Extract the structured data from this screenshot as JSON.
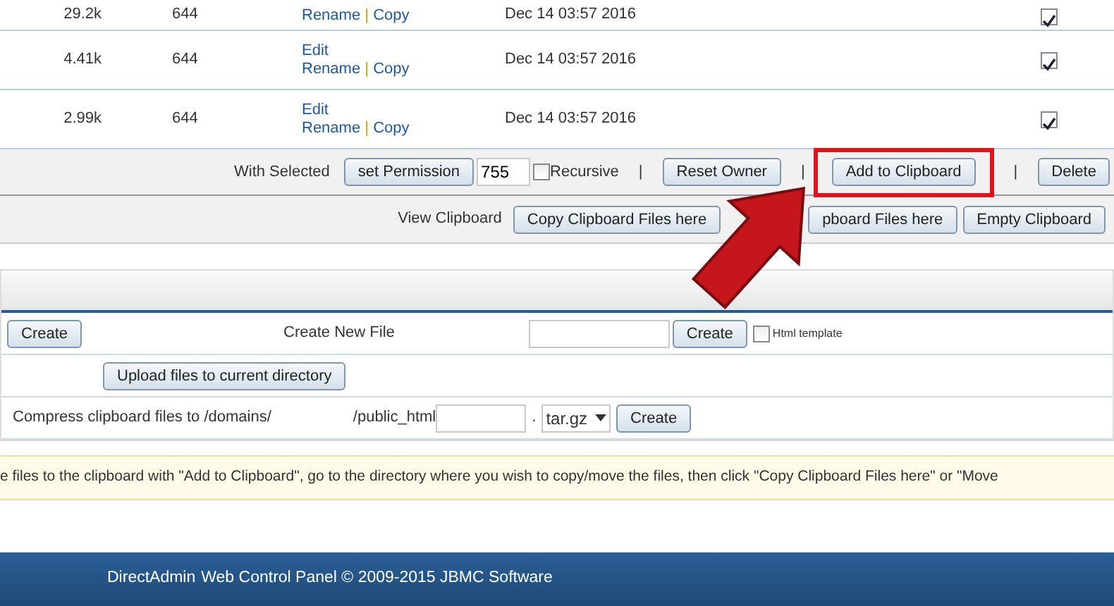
{
  "files": [
    {
      "size": "29.2k",
      "permission": "644",
      "actions": [
        "Rename",
        "Copy"
      ],
      "date": "Dec 14 03:57 2016",
      "checked": true
    },
    {
      "size": "4.41k",
      "permission": "644",
      "edit": "Edit",
      "actions": [
        "Rename",
        "Copy"
      ],
      "date": "Dec 14 03:57 2016",
      "checked": true
    },
    {
      "size": "2.99k",
      "permission": "644",
      "edit": "Edit",
      "actions": [
        "Rename",
        "Copy"
      ],
      "date": "Dec 14 03:57 2016",
      "checked": true
    }
  ],
  "action_separator": "|",
  "with_selected": {
    "label": "With Selected",
    "set_permission": "set Permission",
    "permission_value": "755",
    "recursive": {
      "label": "Recursive",
      "checked": false
    },
    "buttons": [
      {
        "separator": "|",
        "label": "Reset Owner",
        "highlighted": false
      },
      {
        "separator": "|",
        "label": "Add to Clipboard",
        "highlighted": true
      },
      {
        "separator": "|",
        "label": "Delete",
        "highlighted": false
      }
    ]
  },
  "clipboard": {
    "label": "View Clipboard",
    "buttons": [
      "Copy Clipboard Files here",
      "pboard Files here",
      "Empty Clipboard"
    ]
  },
  "create": {
    "folder_button": "Create",
    "file_label": "Create New File",
    "file_button": "Create",
    "html_template": {
      "label": "Html template",
      "checked": false
    },
    "upload_button": "Upload files to current directory",
    "compress_label": "Compress clipboard files to /domains/",
    "compress_path": "/public_html",
    "compress_dot": ".",
    "compress_format": "tar.gz",
    "compress_button": "Create"
  },
  "notice": "e files to the clipboard with \"Add to Clipboard\", go to the directory where you wish to copy/move the files, then click \"Copy Clipboard Files here\" or \"Move",
  "footer": {
    "link": "DirectAdmin",
    "text": "Web Control Panel © 2009-2015 JBMC Software"
  }
}
